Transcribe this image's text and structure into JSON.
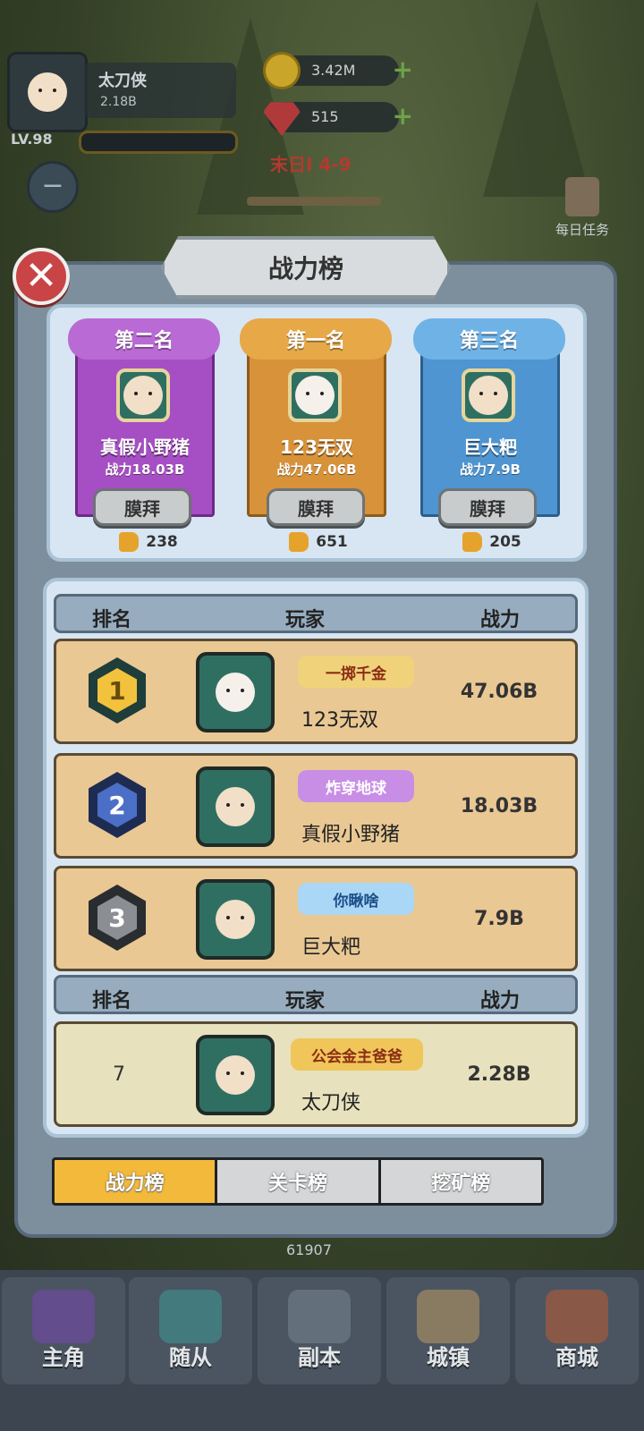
{
  "player": {
    "name": "太刀侠",
    "power": "2.18B",
    "level": "LV.98"
  },
  "resources": {
    "gold": "3.42M",
    "gems": "515"
  },
  "stage": "末日I 4-9",
  "daily_tasks_label": "每日任务",
  "modal": {
    "title": "战力榜"
  },
  "podium": [
    {
      "rank_label": "第二名",
      "name": "真假小野猪",
      "power": "战力18.03B",
      "worship_label": "膜拜",
      "likes": "238"
    },
    {
      "rank_label": "第一名",
      "name": "123无双",
      "power": "战力47.06B",
      "worship_label": "膜拜",
      "likes": "651"
    },
    {
      "rank_label": "第三名",
      "name": "巨大粑",
      "power": "战力7.9B",
      "worship_label": "膜拜",
      "likes": "205"
    }
  ],
  "table": {
    "headers": {
      "rank": "排名",
      "player": "玩家",
      "power": "战力"
    },
    "rows": [
      {
        "rank": "1",
        "title": "一掷千金",
        "name": "123无双",
        "power": "47.06B"
      },
      {
        "rank": "2",
        "title": "炸穿地球",
        "name": "真假小野猪",
        "power": "18.03B"
      },
      {
        "rank": "3",
        "title": "你瞅啥",
        "name": "巨大粑",
        "power": "7.9B"
      }
    ],
    "self_row": {
      "rank": "7",
      "title": "公会金主爸爸",
      "name": "太刀侠",
      "power": "2.28B"
    }
  },
  "tabs": [
    "战力榜",
    "关卡榜",
    "挖矿榜"
  ],
  "bottom_number": "61907",
  "nav": [
    "主角",
    "随从",
    "副本",
    "城镇",
    "商城"
  ],
  "colors": {
    "gold_tab": "#f2b93b",
    "second_purple": "#a64fc4",
    "first_orange": "#d7923a",
    "third_blue": "#4f95d1",
    "row_bg": "#e9c894",
    "self_row_bg": "#e7e1bd"
  }
}
